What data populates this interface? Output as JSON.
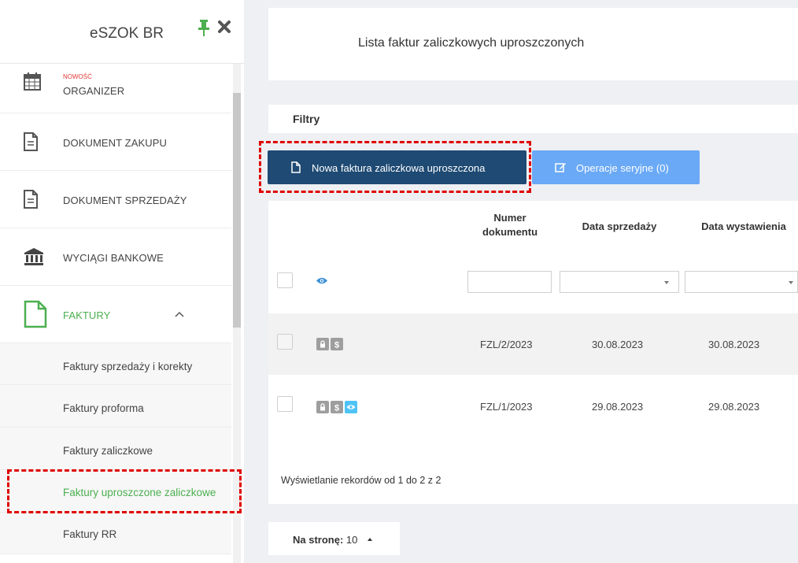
{
  "sidebar": {
    "app_title": "eSZOK BR",
    "menu": [
      {
        "badge": "NOWOŚĆ",
        "label": "ORGANIZER"
      },
      {
        "label": "DOKUMENT ZAKUPU"
      },
      {
        "label": "DOKUMENT SPRZEDAŻY"
      },
      {
        "label": "WYCIĄGI BANKOWE"
      },
      {
        "label": "FAKTURY"
      }
    ],
    "submenu": [
      {
        "label": "Faktury sprzedaży i korekty"
      },
      {
        "label": "Faktury proforma"
      },
      {
        "label": "Faktury zaliczkowe"
      },
      {
        "label": "Faktury uproszczone zaliczkowe"
      },
      {
        "label": "Faktury RR"
      }
    ],
    "accent": "#4caf50"
  },
  "main": {
    "page_title": "Lista faktur zaliczkowych uproszczonych",
    "filters_label": "Filtry",
    "new_button_label": "Nowa faktura zaliczkowa uproszczona",
    "bulk_button_label": "Operacje seryjne (0)",
    "columns": {
      "number": "Numer dokumentu",
      "sale_date": "Data sprzedaży",
      "issue_date": "Data wystawienia"
    },
    "rows": [
      {
        "number": "FZL/2/2023",
        "sale_date": "30.08.2023",
        "issue_date": "30.08.2023",
        "icons": [
          "lock-icon",
          "dollar-icon"
        ]
      },
      {
        "number": "FZL/1/2023",
        "sale_date": "29.08.2023",
        "issue_date": "29.08.2023",
        "icons": [
          "lock-icon",
          "dollar-icon",
          "eye-icon"
        ]
      }
    ],
    "footer": "Wyświetlanie rekordów od 1 do 2 z 2",
    "per_page_label": "Na stronę:",
    "per_page_value": "10",
    "primary_color": "#1e4a73",
    "secondary_color": "#6aa9f5",
    "highlight_color": "#e00000"
  }
}
